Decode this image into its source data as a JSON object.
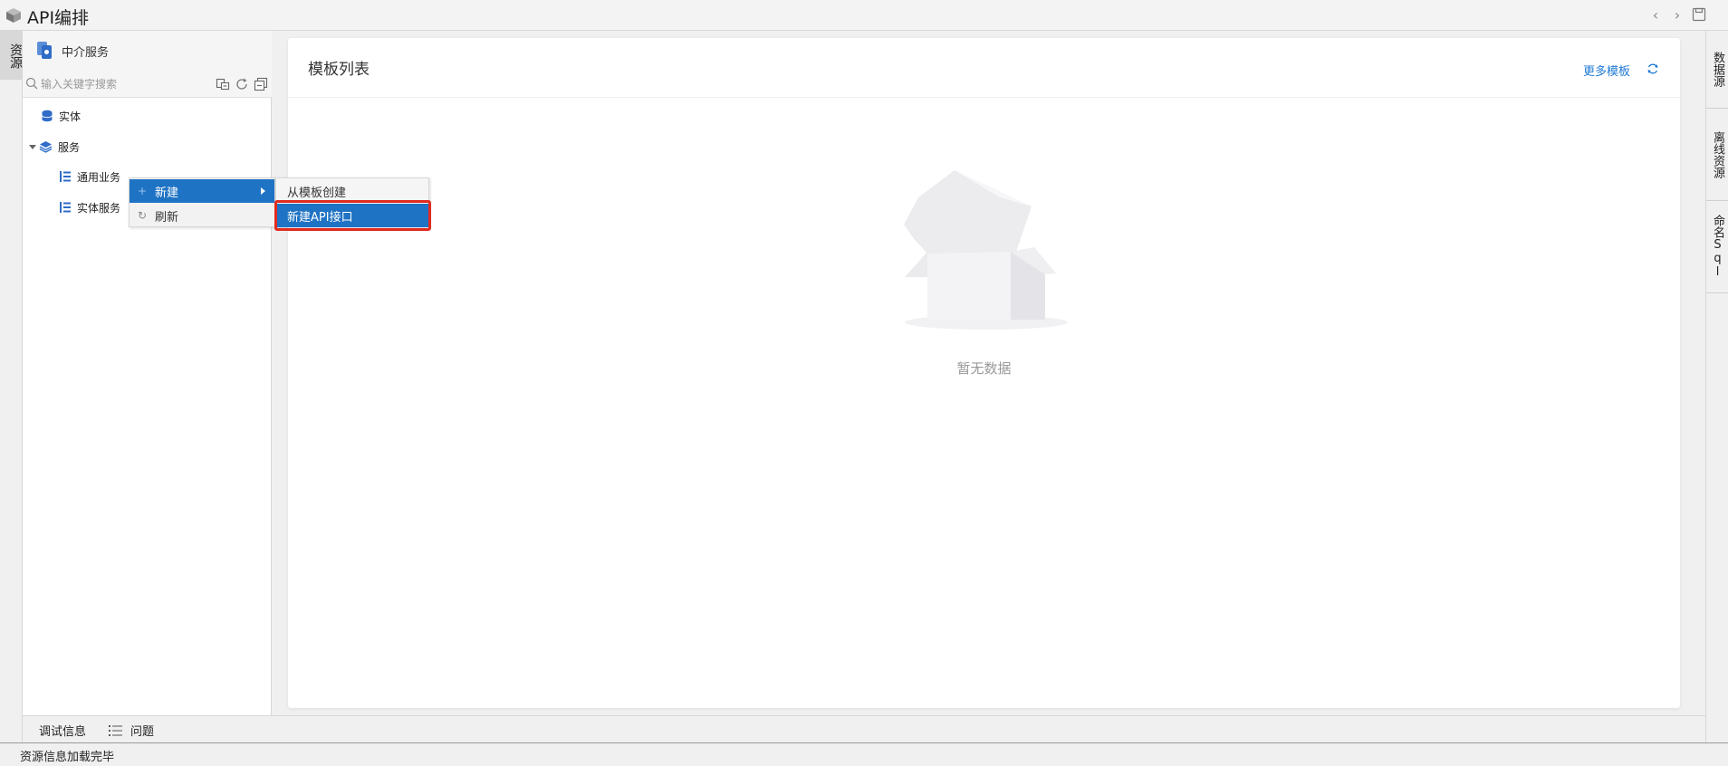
{
  "window": {
    "title": "API编排",
    "nav_back_icon": "chevron-left-icon",
    "nav_forward_icon": "chevron-right-icon",
    "save_icon": "save-icon"
  },
  "left_rail": {
    "tabs": [
      {
        "label": "资源"
      }
    ]
  },
  "right_rail": {
    "tabs": [
      {
        "label": "数据源"
      },
      {
        "label": "离线资源"
      },
      {
        "label": "命名Sql"
      }
    ]
  },
  "resource_panel": {
    "header": {
      "name": "中介服务"
    },
    "search": {
      "placeholder": "输入关键字搜索"
    },
    "tree": [
      {
        "label": "实体",
        "icon": "database-icon"
      },
      {
        "label": "服务",
        "icon": "layers-icon",
        "expanded": true
      },
      {
        "label": "通用业务",
        "icon": "service-group-icon"
      },
      {
        "label": "实体服务",
        "icon": "service-group-icon"
      }
    ]
  },
  "context_menu": {
    "items": [
      {
        "label": "新建",
        "icon": "plus-icon",
        "has_submenu": true
      },
      {
        "label": "刷新",
        "icon": "refresh-icon"
      }
    ],
    "submenu": [
      {
        "label": "从模板创建"
      },
      {
        "label": "新建API接口"
      }
    ]
  },
  "main": {
    "title": "模板列表",
    "more_link": "更多模板",
    "empty_text": "暂无数据"
  },
  "bottom_tabs": [
    {
      "label": "调试信息"
    },
    {
      "label": "问题",
      "icon": "list-icon"
    }
  ],
  "status": {
    "text": "资源信息加载完毕"
  },
  "colors": {
    "accent": "#1f73c4",
    "link": "#1f7ad6",
    "highlight": "#e12b1f"
  }
}
